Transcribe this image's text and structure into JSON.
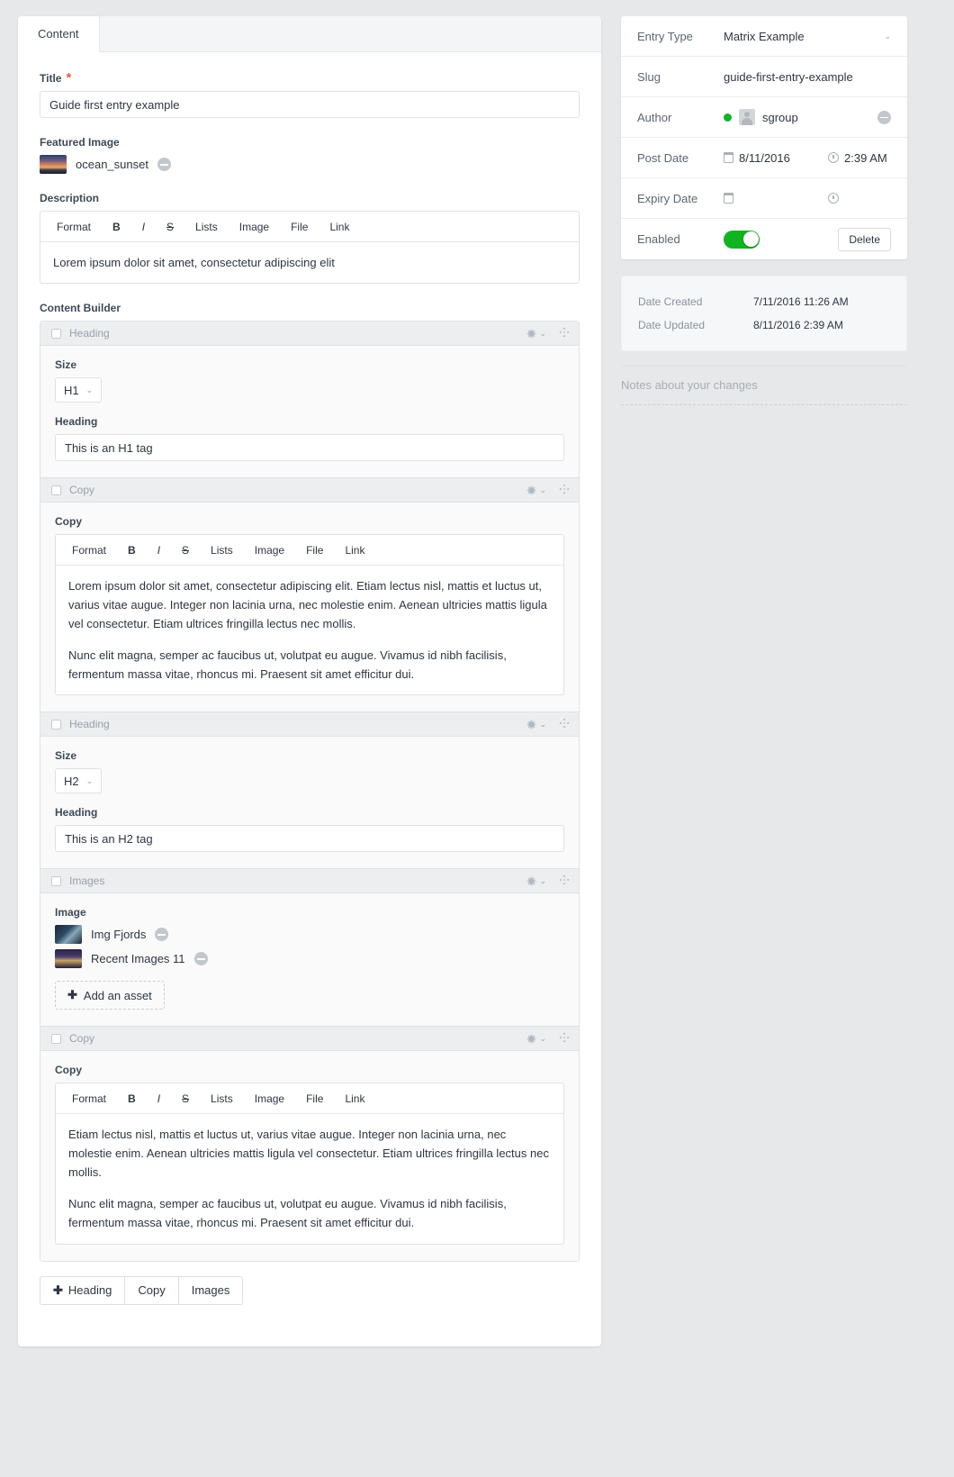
{
  "main": {
    "tab_label": "Content",
    "title": {
      "label": "Title",
      "required_marker": "*",
      "value": "Guide first entry example"
    },
    "featured_image": {
      "label": "Featured Image",
      "asset_name": "ocean_sunset"
    },
    "description": {
      "label": "Description",
      "toolbar": [
        "Format",
        "B",
        "I",
        "S",
        "Lists",
        "Image",
        "File",
        "Link"
      ],
      "body": "Lorem ipsum dolor sit amet, consectetur adipiscing elit"
    },
    "content_builder": {
      "label": "Content Builder",
      "blocks": [
        {
          "type": "Heading",
          "size_label": "Size",
          "size_value": "H1",
          "heading_label": "Heading",
          "heading_value": "This is an H1 tag"
        },
        {
          "type": "Copy",
          "copy_label": "Copy",
          "toolbar": [
            "Format",
            "B",
            "I",
            "S",
            "Lists",
            "Image",
            "File",
            "Link"
          ],
          "paragraphs": [
            "Lorem ipsum dolor sit amet, consectetur adipiscing elit. Etiam lectus nisl, mattis et luctus ut, varius vitae augue. Integer non lacinia urna, nec molestie enim. Aenean ultricies mattis ligula vel consectetur. Etiam ultrices fringilla lectus nec mollis.",
            "Nunc elit magna, semper ac faucibus ut, volutpat eu augue. Vivamus id nibh facilisis, fermentum massa vitae, rhoncus mi. Praesent sit amet efficitur dui."
          ]
        },
        {
          "type": "Heading",
          "size_label": "Size",
          "size_value": "H2",
          "heading_label": "Heading",
          "heading_value": "This is an H2 tag"
        },
        {
          "type": "Images",
          "image_label": "Image",
          "assets": [
            "Img Fjords",
            "Recent Images 11"
          ],
          "add_asset_label": "Add an asset"
        },
        {
          "type": "Copy",
          "copy_label": "Copy",
          "toolbar": [
            "Format",
            "B",
            "I",
            "S",
            "Lists",
            "Image",
            "File",
            "Link"
          ],
          "paragraphs": [
            "Etiam lectus nisl, mattis et luctus ut, varius vitae augue. Integer non lacinia urna, nec molestie enim. Aenean ultricies mattis ligula vel consectetur. Etiam ultrices fringilla lectus nec mollis.",
            "Nunc elit magna, semper ac faucibus ut, volutpat eu augue. Vivamus id nibh facilisis, fermentum massa vitae, rhoncus mi. Praesent sit amet efficitur dui."
          ]
        }
      ],
      "add_buttons": [
        "Heading",
        "Copy",
        "Images"
      ]
    }
  },
  "sidebar": {
    "entry_type": {
      "label": "Entry Type",
      "value": "Matrix Example"
    },
    "slug": {
      "label": "Slug",
      "value": "guide-first-entry-example"
    },
    "author": {
      "label": "Author",
      "value": "sgroup"
    },
    "post_date": {
      "label": "Post Date",
      "date": "8/11/2016",
      "time": "2:39 AM"
    },
    "expiry_date": {
      "label": "Expiry Date",
      "date": "",
      "time": ""
    },
    "enabled": {
      "label": "Enabled",
      "delete_label": "Delete"
    },
    "meta": [
      {
        "label": "Date Created",
        "value": "7/11/2016 11:26 AM"
      },
      {
        "label": "Date Updated",
        "value": "8/11/2016 2:39 AM"
      }
    ],
    "notes_placeholder": "Notes about your changes"
  },
  "colors": {
    "accent_green": "#17b130",
    "required_red": "#e5603f",
    "page_bg": "#e7e8ea"
  }
}
